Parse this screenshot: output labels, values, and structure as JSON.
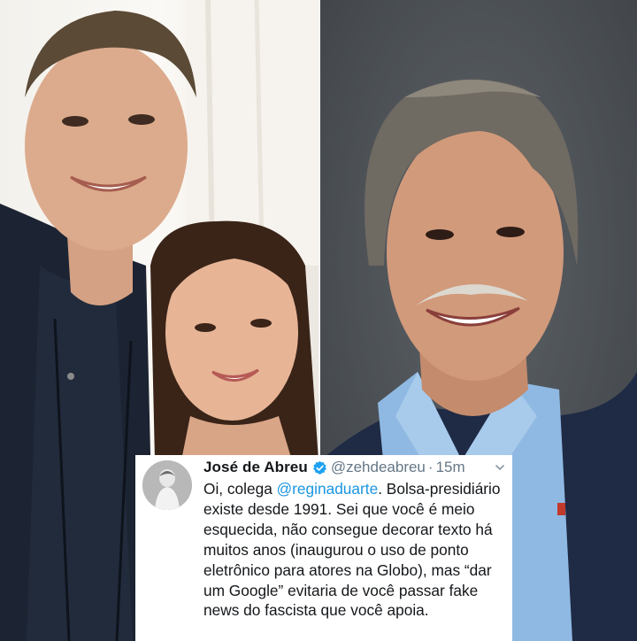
{
  "tweet": {
    "display_name": "José de Abreu",
    "handle": "@zehdeabreu",
    "separator": "·",
    "time": "15m",
    "text_before_mention": "Oi, colega ",
    "mention": "@reginaduarte",
    "text_after_mention": ". Bolsa-presidiário existe desde 1991. Sei que você é meio esquecida, não consegue decorar texto há muitos anos (inaugurou o uso de ponto eletrônico para atores na Globo), mas “dar um Google” evitaria de você passar fake news do fascista que você apoia."
  },
  "icons": {
    "verified": "verified-badge-icon",
    "menu": "chevron-down-icon"
  },
  "colors": {
    "name_text": "#14171a",
    "meta_text": "#657786",
    "mention_link": "#1b95e0",
    "verified_badge": "#1da1f2"
  }
}
